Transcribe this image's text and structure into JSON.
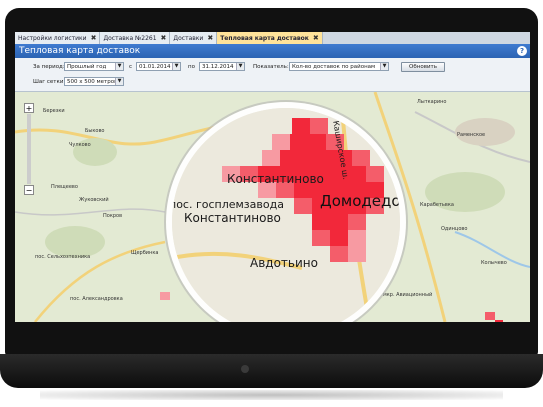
{
  "tabs": [
    {
      "label": "Настройки логистики"
    },
    {
      "label": "Доставка №2261"
    },
    {
      "label": "Доставки"
    },
    {
      "label": "Тепловая карта доставок"
    }
  ],
  "tab_close_glyph": "✖",
  "title": "Тепловая карта доставок",
  "help_glyph": "?",
  "filters": {
    "period_label": "За период:",
    "period_value": "Прошлый год",
    "from_label": "с",
    "from_value": "01.01.2014",
    "to_label": "по",
    "to_value": "31.12.2014",
    "indicator_label": "Показатель:",
    "indicator_value": "Кол-во доставок по районам",
    "refresh_button": "Обновить",
    "grid_label": "Шаг сетки:",
    "grid_value": "500 х 500 метров",
    "dropdown_glyph": "▼"
  },
  "zoom": {
    "plus": "+",
    "minus": "−"
  },
  "map_labels": [
    "Березки",
    "Быково",
    "Чулково",
    "Раменское",
    "Лыткарино",
    "Плещеево",
    "Жуковский",
    "Покров",
    "Щербинка",
    "пос. Сельхозтехника",
    "пос. Александровка",
    "Каширское ш.",
    "Карабетьвка",
    "Одинцово",
    "Колычево",
    "мкр. Авиационный"
  ],
  "lens_labels": {
    "l1": "Константиново",
    "l2": "пос. госплемзавода",
    "l3": "Константиново",
    "l4": "Домодедов",
    "l5": "Авдотьино",
    "l6": "Каширское ш."
  },
  "colors": {
    "heat_strong": "#f2283a",
    "heat_mid": "#f45d6a",
    "heat_light": "#f79aa2",
    "accent": "#2b63b3"
  }
}
